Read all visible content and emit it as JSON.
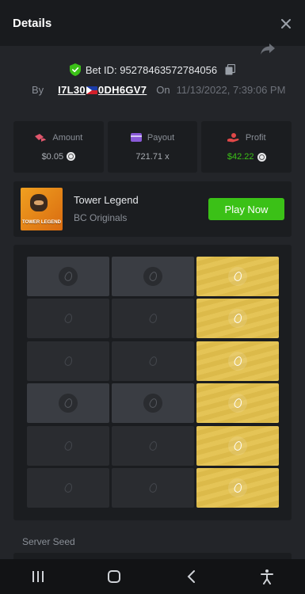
{
  "header": {
    "title": "Details"
  },
  "bet": {
    "id_label": "Bet ID: 95278463572784056",
    "by_label": "By",
    "player_part1": "I7L30",
    "player_part2": "0DH6GV7",
    "on_label": "On",
    "datetime": "11/13/2022, 7:39:06 PM"
  },
  "stats": {
    "amount": {
      "label": "Amount",
      "value": "$0.05",
      "icon": "money-wings-icon"
    },
    "payout": {
      "label": "Payout",
      "value": "721.71 x",
      "icon": "card-icon"
    },
    "profit": {
      "label": "Profit",
      "value": "$42.22",
      "icon": "coins-hand-icon"
    }
  },
  "game": {
    "name": "Tower Legend",
    "provider": "BC Originals",
    "thumb_text": "TOWER LEGEND",
    "play_label": "Play Now"
  },
  "board": {
    "rows": [
      [
        "revealed",
        "revealed",
        "gold"
      ],
      [
        "hidden",
        "hidden",
        "gold"
      ],
      [
        "hidden",
        "hidden",
        "gold"
      ],
      [
        "revealed",
        "revealed",
        "gold"
      ],
      [
        "hidden",
        "hidden",
        "gold"
      ],
      [
        "hidden",
        "hidden",
        "gold"
      ]
    ]
  },
  "seed": {
    "label": "Server Seed"
  },
  "colors": {
    "accent_green": "#3bc117",
    "gold_tile": "#e3c04c",
    "background": "#232529",
    "card": "#1b1d20"
  },
  "navbar": {
    "icons": [
      "recent-apps-icon",
      "home-icon",
      "back-icon",
      "accessibility-icon"
    ]
  }
}
